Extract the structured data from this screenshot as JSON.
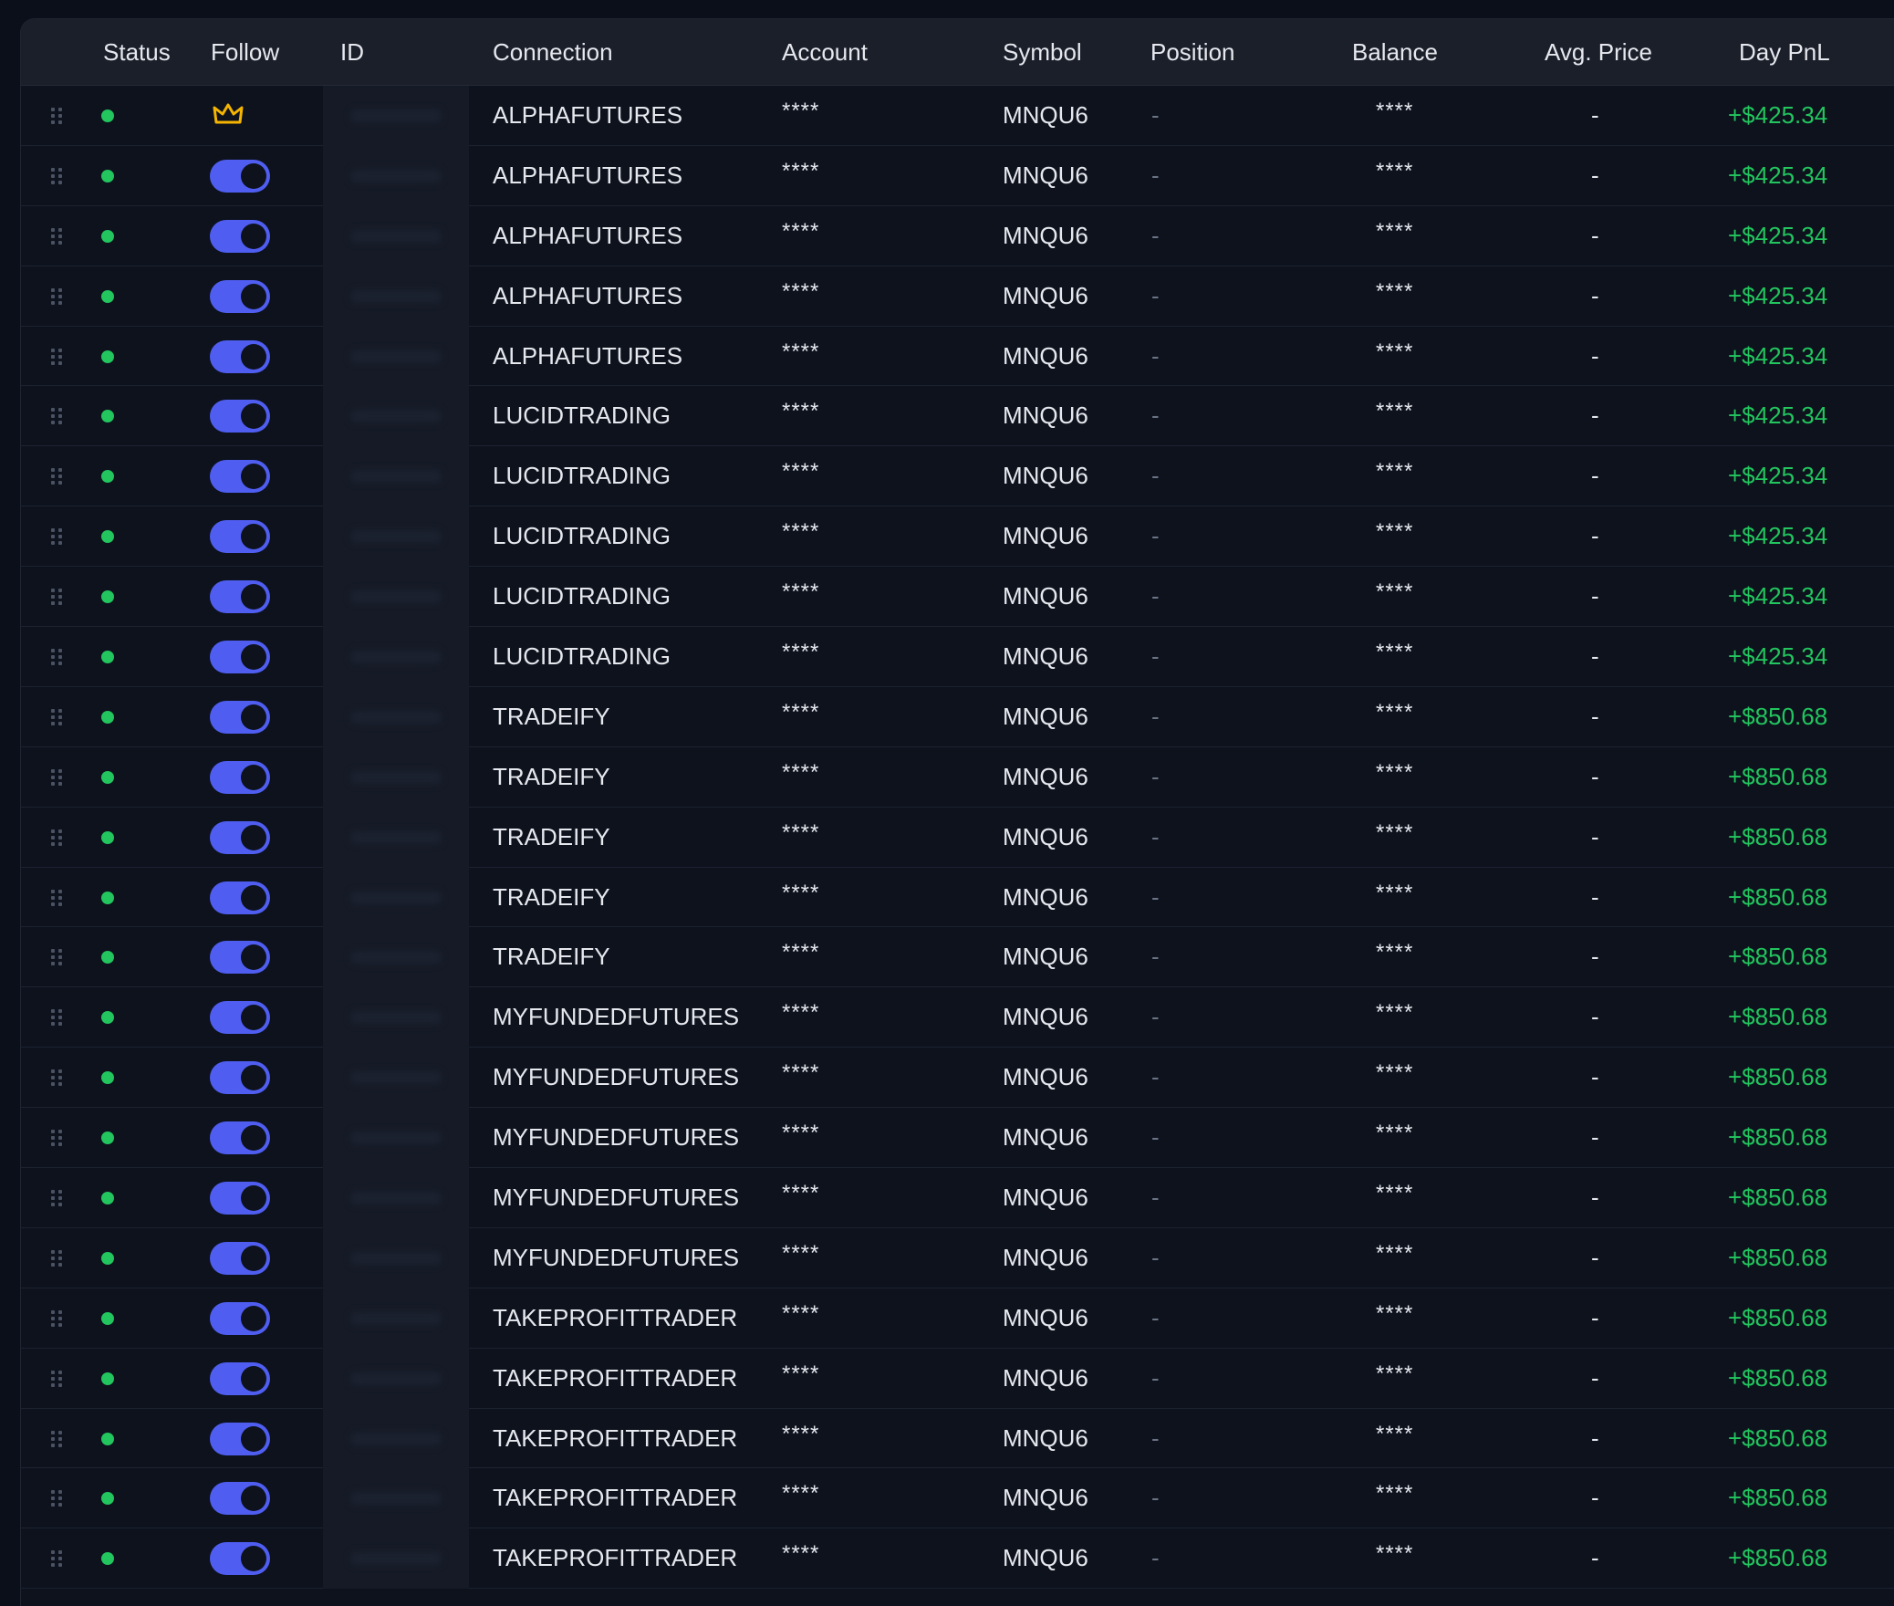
{
  "table": {
    "columns": {
      "status": "Status",
      "follow": "Follow",
      "id": "ID",
      "connection": "Connection",
      "account": "Account",
      "symbol": "Symbol",
      "position": "Position",
      "balance": "Balance",
      "avg_price": "Avg. Price",
      "day_pnl": "Day PnL"
    },
    "rows": [
      {
        "follow": "leader",
        "connection": "ALPHAFUTURES",
        "account": "****",
        "symbol": "MNQU6",
        "position": "-",
        "balance": "****",
        "avg_price": "-",
        "day_pnl": "+$425.34"
      },
      {
        "follow": "on",
        "connection": "ALPHAFUTURES",
        "account": "****",
        "symbol": "MNQU6",
        "position": "-",
        "balance": "****",
        "avg_price": "-",
        "day_pnl": "+$425.34"
      },
      {
        "follow": "on",
        "connection": "ALPHAFUTURES",
        "account": "****",
        "symbol": "MNQU6",
        "position": "-",
        "balance": "****",
        "avg_price": "-",
        "day_pnl": "+$425.34"
      },
      {
        "follow": "on",
        "connection": "ALPHAFUTURES",
        "account": "****",
        "symbol": "MNQU6",
        "position": "-",
        "balance": "****",
        "avg_price": "-",
        "day_pnl": "+$425.34"
      },
      {
        "follow": "on",
        "connection": "ALPHAFUTURES",
        "account": "****",
        "symbol": "MNQU6",
        "position": "-",
        "balance": "****",
        "avg_price": "-",
        "day_pnl": "+$425.34"
      },
      {
        "follow": "on",
        "connection": "LUCIDTRADING",
        "account": "****",
        "symbol": "MNQU6",
        "position": "-",
        "balance": "****",
        "avg_price": "-",
        "day_pnl": "+$425.34"
      },
      {
        "follow": "on",
        "connection": "LUCIDTRADING",
        "account": "****",
        "symbol": "MNQU6",
        "position": "-",
        "balance": "****",
        "avg_price": "-",
        "day_pnl": "+$425.34"
      },
      {
        "follow": "on",
        "connection": "LUCIDTRADING",
        "account": "****",
        "symbol": "MNQU6",
        "position": "-",
        "balance": "****",
        "avg_price": "-",
        "day_pnl": "+$425.34"
      },
      {
        "follow": "on",
        "connection": "LUCIDTRADING",
        "account": "****",
        "symbol": "MNQU6",
        "position": "-",
        "balance": "****",
        "avg_price": "-",
        "day_pnl": "+$425.34"
      },
      {
        "follow": "on",
        "connection": "LUCIDTRADING",
        "account": "****",
        "symbol": "MNQU6",
        "position": "-",
        "balance": "****",
        "avg_price": "-",
        "day_pnl": "+$425.34"
      },
      {
        "follow": "on",
        "connection": "TRADEIFY",
        "account": "****",
        "symbol": "MNQU6",
        "position": "-",
        "balance": "****",
        "avg_price": "-",
        "day_pnl": "+$850.68"
      },
      {
        "follow": "on",
        "connection": "TRADEIFY",
        "account": "****",
        "symbol": "MNQU6",
        "position": "-",
        "balance": "****",
        "avg_price": "-",
        "day_pnl": "+$850.68"
      },
      {
        "follow": "on",
        "connection": "TRADEIFY",
        "account": "****",
        "symbol": "MNQU6",
        "position": "-",
        "balance": "****",
        "avg_price": "-",
        "day_pnl": "+$850.68"
      },
      {
        "follow": "on",
        "connection": "TRADEIFY",
        "account": "****",
        "symbol": "MNQU6",
        "position": "-",
        "balance": "****",
        "avg_price": "-",
        "day_pnl": "+$850.68"
      },
      {
        "follow": "on",
        "connection": "TRADEIFY",
        "account": "****",
        "symbol": "MNQU6",
        "position": "-",
        "balance": "****",
        "avg_price": "-",
        "day_pnl": "+$850.68"
      },
      {
        "follow": "on",
        "connection": "MYFUNDEDFUTURES",
        "account": "****",
        "symbol": "MNQU6",
        "position": "-",
        "balance": "****",
        "avg_price": "-",
        "day_pnl": "+$850.68"
      },
      {
        "follow": "on",
        "connection": "MYFUNDEDFUTURES",
        "account": "****",
        "symbol": "MNQU6",
        "position": "-",
        "balance": "****",
        "avg_price": "-",
        "day_pnl": "+$850.68"
      },
      {
        "follow": "on",
        "connection": "MYFUNDEDFUTURES",
        "account": "****",
        "symbol": "MNQU6",
        "position": "-",
        "balance": "****",
        "avg_price": "-",
        "day_pnl": "+$850.68"
      },
      {
        "follow": "on",
        "connection": "MYFUNDEDFUTURES",
        "account": "****",
        "symbol": "MNQU6",
        "position": "-",
        "balance": "****",
        "avg_price": "-",
        "day_pnl": "+$850.68"
      },
      {
        "follow": "on",
        "connection": "MYFUNDEDFUTURES",
        "account": "****",
        "symbol": "MNQU6",
        "position": "-",
        "balance": "****",
        "avg_price": "-",
        "day_pnl": "+$850.68"
      },
      {
        "follow": "on",
        "connection": "TAKEPROFITTRADER",
        "account": "****",
        "symbol": "MNQU6",
        "position": "-",
        "balance": "****",
        "avg_price": "-",
        "day_pnl": "+$850.68"
      },
      {
        "follow": "on",
        "connection": "TAKEPROFITTRADER",
        "account": "****",
        "symbol": "MNQU6",
        "position": "-",
        "balance": "****",
        "avg_price": "-",
        "day_pnl": "+$850.68"
      },
      {
        "follow": "on",
        "connection": "TAKEPROFITTRADER",
        "account": "****",
        "symbol": "MNQU6",
        "position": "-",
        "balance": "****",
        "avg_price": "-",
        "day_pnl": "+$850.68"
      },
      {
        "follow": "on",
        "connection": "TAKEPROFITTRADER",
        "account": "****",
        "symbol": "MNQU6",
        "position": "-",
        "balance": "****",
        "avg_price": "-",
        "day_pnl": "+$850.68"
      },
      {
        "follow": "on",
        "connection": "TAKEPROFITTRADER",
        "account": "****",
        "symbol": "MNQU6",
        "position": "-",
        "balance": "****",
        "avg_price": "-",
        "day_pnl": "+$850.68"
      }
    ]
  },
  "colors": {
    "status_online": "#22c55e",
    "toggle_on": "#4f5ef0",
    "pnl_positive": "#22c55e",
    "leader_crown": "#f5b400"
  },
  "icons": {
    "drag_handle": "drag-handle-icon",
    "status": "status-dot-icon",
    "leader": "crown-icon"
  }
}
